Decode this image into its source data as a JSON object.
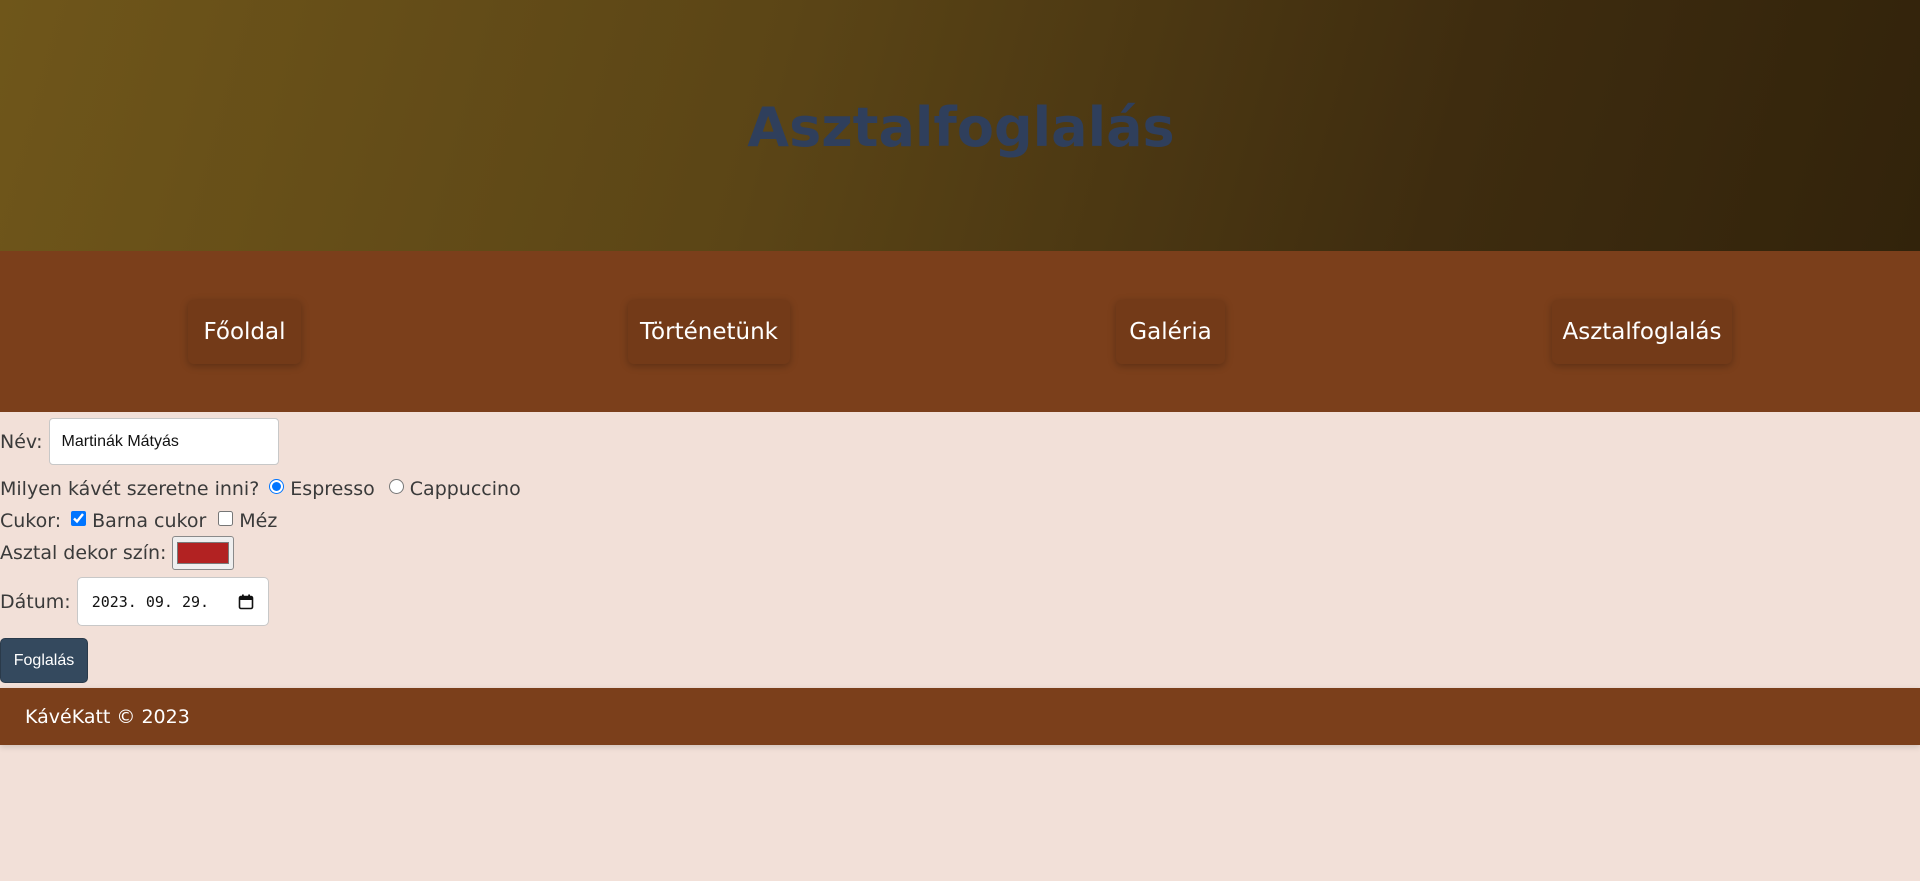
{
  "header": {
    "title": "Asztalfoglalás"
  },
  "nav": {
    "items": [
      {
        "label": "Főoldal"
      },
      {
        "label": "Történetünk"
      },
      {
        "label": "Galéria"
      },
      {
        "label": "Asztalfoglalás"
      }
    ]
  },
  "form": {
    "name_label": "Név:",
    "name_value": "Martinák Mátyás",
    "coffee_label": "Milyen kávét szeretne inni?",
    "coffee_options": [
      {
        "label": "Espresso",
        "selected": true
      },
      {
        "label": "Cappuccino",
        "selected": false
      }
    ],
    "sugar_label": "Cukor:",
    "sugar_options": [
      {
        "label": "Barna cukor",
        "checked": true
      },
      {
        "label": "Méz",
        "checked": false
      }
    ],
    "color_label": "Asztal dekor szín:",
    "color_value": "#b22222",
    "date_label": "Dátum:",
    "date_value": "2023. 09. 29.",
    "submit_label": "Foglalás"
  },
  "footer": {
    "text": "KávéKatt © 2023"
  },
  "colors": {
    "nav_bg": "#7b3f1b",
    "page_bg": "#f2e0d8",
    "title": "#2f3f5c",
    "button": "#34495e"
  }
}
